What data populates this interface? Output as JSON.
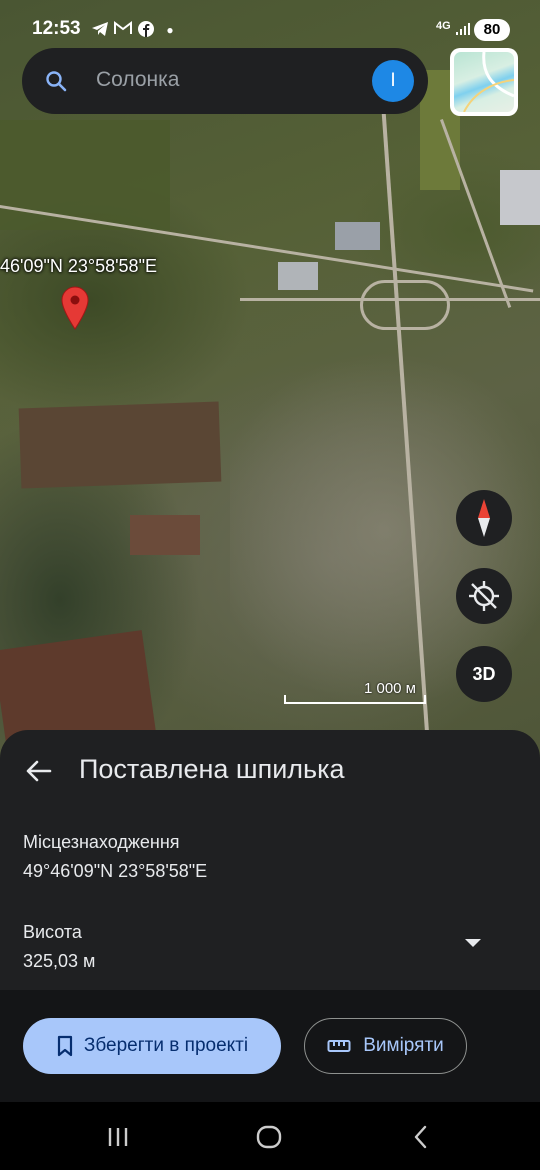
{
  "status_bar": {
    "time": "12:53",
    "network": "4G",
    "battery": "80",
    "icons": [
      "telegram-icon",
      "gmail-icon",
      "facebook-icon",
      "dot-icon",
      "signal-icon"
    ]
  },
  "search": {
    "query": "Солонка",
    "avatar_letter": "I"
  },
  "map": {
    "pin_coordinates": "46'09\"N 23°58'58\"E",
    "scale_label": "1 000 м",
    "three_d_label": "3D"
  },
  "sheet": {
    "title": "Поставлена шпилька",
    "location_label": "Місцезнаходження",
    "location_value": "49°46'09\"N 23°58'58\"E",
    "altitude_label": "Висота",
    "altitude_value": "325,03 м"
  },
  "actions": {
    "save_label": "Зберегти в проекті",
    "measure_label": "Виміряти"
  },
  "colors": {
    "sheet_bg": "#1f2022",
    "accent": "#a8c7fa",
    "avatar": "#1e88e5",
    "pin": "#e53935"
  }
}
